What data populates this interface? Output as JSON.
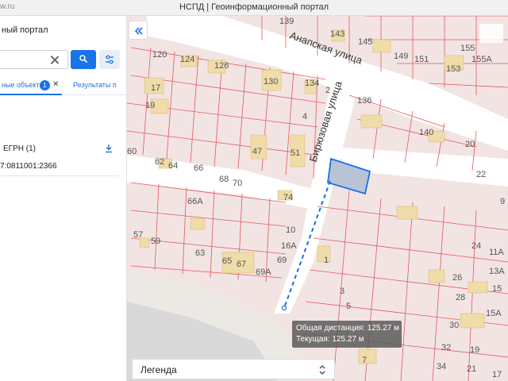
{
  "browser": {
    "url_fragment": "w.ru",
    "window_title": "НСПД | Геоинформационный портал"
  },
  "panel": {
    "portal_name": "ный портал",
    "search": {
      "value": "",
      "placeholder": ""
    },
    "tabs": [
      {
        "label": "ные объекты",
        "count": "1",
        "active": true
      },
      {
        "label": "Результаты п",
        "active": false
      }
    ],
    "section_title": "ЕГРН (1)",
    "result_cad_number": "7:0811001:2366"
  },
  "map": {
    "street_labels": [
      "Анапская улица",
      "Бирюзовая улица"
    ],
    "parcel_numbers": [
      "139",
      "143",
      "145",
      "149",
      "151",
      "153",
      "155",
      "155А",
      "120",
      "124",
      "126",
      "130",
      "134",
      "2",
      "136",
      "17",
      "19",
      "4",
      "140",
      "20",
      "47",
      "51",
      "22",
      "60",
      "62",
      "64",
      "66",
      "68",
      "70",
      "74",
      "9",
      "66А",
      "10",
      "16А",
      "24",
      "11А",
      "57",
      "59",
      "63",
      "65",
      "67",
      "69",
      "69А",
      "1",
      "26",
      "13А",
      "3",
      "28",
      "15",
      "5",
      "30",
      "32",
      "7",
      "19",
      "34",
      "21",
      "15А",
      "17"
    ],
    "selected_parcel_color": "#b9c3d6",
    "parcel_border_color": "#e05a5a",
    "measure_line_color": "#1a6fe0",
    "measure": {
      "total": "Общая дистанция: 125.27 м",
      "current": "Текущая: 125.27 м"
    },
    "legend_label": "Легенда"
  },
  "icons": {
    "search": "search-icon",
    "filter": "filter-icon",
    "clear": "close-icon",
    "download": "download-icon",
    "collapse": "double-chevron-left-icon",
    "legend_toggle": "chevron-updown-icon"
  },
  "colors": {
    "accent": "#1a73e8",
    "map_background": "#f3e4e4",
    "road": "#ffffff",
    "building": "#efdca8"
  }
}
